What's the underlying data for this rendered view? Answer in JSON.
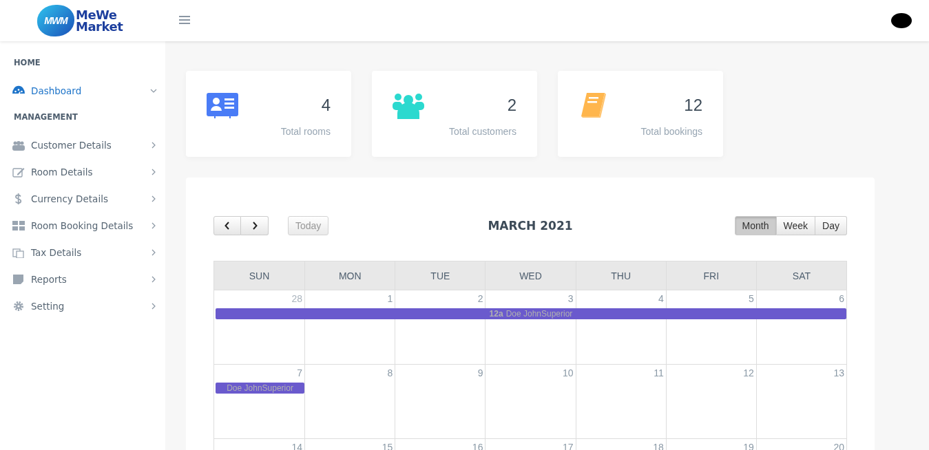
{
  "header": {
    "logo_mark": "MWM",
    "logo_text_top": "MeWe",
    "logo_text_bottom": "Market"
  },
  "sidebar": {
    "sections": [
      {
        "heading": "HOME",
        "items": [
          {
            "label": "Dashboard",
            "selected": true,
            "expanded": true
          }
        ]
      },
      {
        "heading": "MANAGEMENT",
        "items": [
          {
            "label": "Customer Details",
            "selected": false,
            "expanded": false
          },
          {
            "label": "Room Details",
            "selected": false,
            "expanded": false
          },
          {
            "label": "Currency Details",
            "selected": false,
            "expanded": false
          },
          {
            "label": "Room Booking Details",
            "selected": false,
            "expanded": false
          },
          {
            "label": "Tax Details",
            "selected": false,
            "expanded": false
          },
          {
            "label": "Reports",
            "selected": false,
            "expanded": false
          },
          {
            "label": "Setting",
            "selected": false,
            "expanded": false
          }
        ]
      }
    ]
  },
  "stats": [
    {
      "value": "4",
      "label": "Total rooms",
      "color": "#4a7cf6"
    },
    {
      "value": "2",
      "label": "Total customers",
      "color": "#2bd9cf"
    },
    {
      "value": "12",
      "label": "Total bookings",
      "color": "#ffb64d"
    }
  ],
  "calendar": {
    "title": "MARCH 2021",
    "today_button": "Today",
    "views": [
      {
        "label": "Month",
        "selected": true
      },
      {
        "label": "Week",
        "selected": false
      },
      {
        "label": "Day",
        "selected": false
      }
    ],
    "weekdays": [
      "SUN",
      "MON",
      "TUE",
      "WED",
      "THU",
      "FRI",
      "SAT"
    ],
    "weeks": [
      {
        "days": [
          {
            "number": "28",
            "other_month": true,
            "events": [
              {
                "time": "12a",
                "title": "Doe JohnSuperior",
                "to_week_end": true
              }
            ]
          },
          {
            "number": "1",
            "other_month": false
          },
          {
            "number": "2",
            "other_month": false
          },
          {
            "number": "3",
            "other_month": false
          },
          {
            "number": "4",
            "other_month": false
          },
          {
            "number": "5",
            "other_month": false
          },
          {
            "number": "6",
            "other_month": false
          }
        ]
      },
      {
        "days": [
          {
            "number": "7",
            "other_month": false,
            "events": [
              {
                "title": "Doe JohnSuperior",
                "to_week_end": false
              }
            ]
          },
          {
            "number": "8",
            "other_month": false
          },
          {
            "number": "9",
            "other_month": false
          },
          {
            "number": "10",
            "other_month": false
          },
          {
            "number": "11",
            "other_month": false
          },
          {
            "number": "12",
            "other_month": false
          },
          {
            "number": "13",
            "other_month": false
          }
        ]
      },
      {
        "days": [
          {
            "number": "14",
            "other_month": false
          },
          {
            "number": "15",
            "other_month": false
          },
          {
            "number": "16",
            "other_month": false
          },
          {
            "number": "17",
            "other_month": false
          },
          {
            "number": "18",
            "other_month": false
          },
          {
            "number": "19",
            "other_month": false
          },
          {
            "number": "20",
            "other_month": false
          }
        ]
      }
    ]
  }
}
